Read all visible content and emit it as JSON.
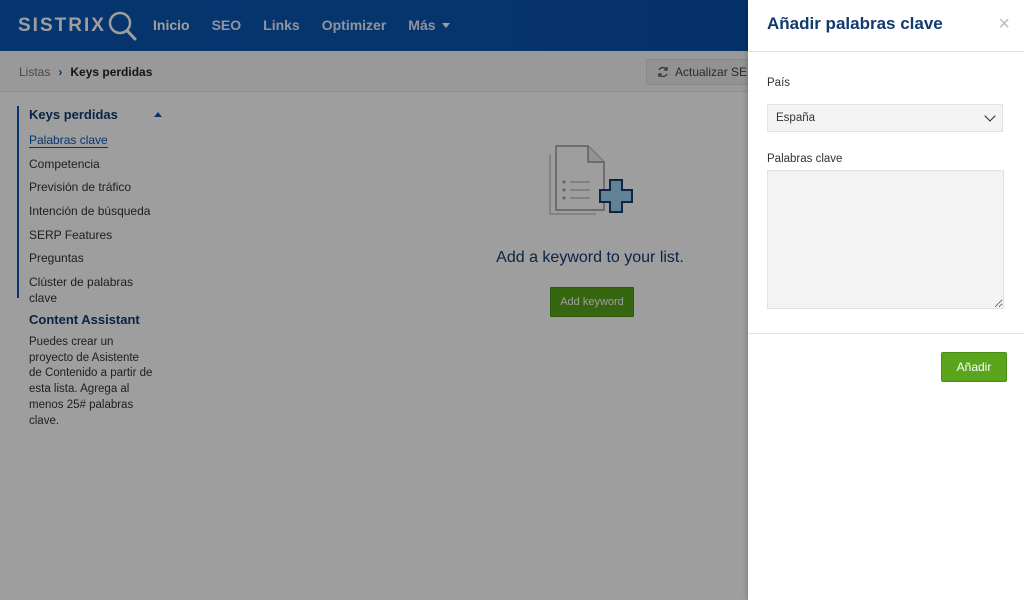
{
  "header": {
    "logo": "SISTRIX",
    "nav": [
      "Inicio",
      "SEO",
      "Links",
      "Optimizer",
      "Más"
    ]
  },
  "breadcrumb": {
    "parent": "Listas",
    "current": "Keys perdidas",
    "refresh_label": "Actualizar SERP"
  },
  "sidebar": {
    "group_title": "Keys perdidas",
    "items": [
      "Palabras clave",
      "Competencia",
      "Previsión de tráfico",
      "Intención de búsqueda",
      "SERP Features",
      "Preguntas",
      "Clúster de palabras clave"
    ],
    "content_assistant_title": "Content Assistant",
    "content_assistant_text": "Puedes crear un proyecto de Asistente de Contenido a partir de esta lista. Agrega al menos 25# palabras clave."
  },
  "empty_state": {
    "title": "Add a keyword to your list.",
    "button": "Add keyword"
  },
  "drawer": {
    "title": "Añadir palabras clave",
    "country_label": "País",
    "country_value": "España",
    "keywords_label": "Palabras clave",
    "keywords_value": "",
    "submit": "Añadir"
  },
  "colors": {
    "brand_blue": "#0b57b4",
    "button_green": "#5aa51c"
  }
}
